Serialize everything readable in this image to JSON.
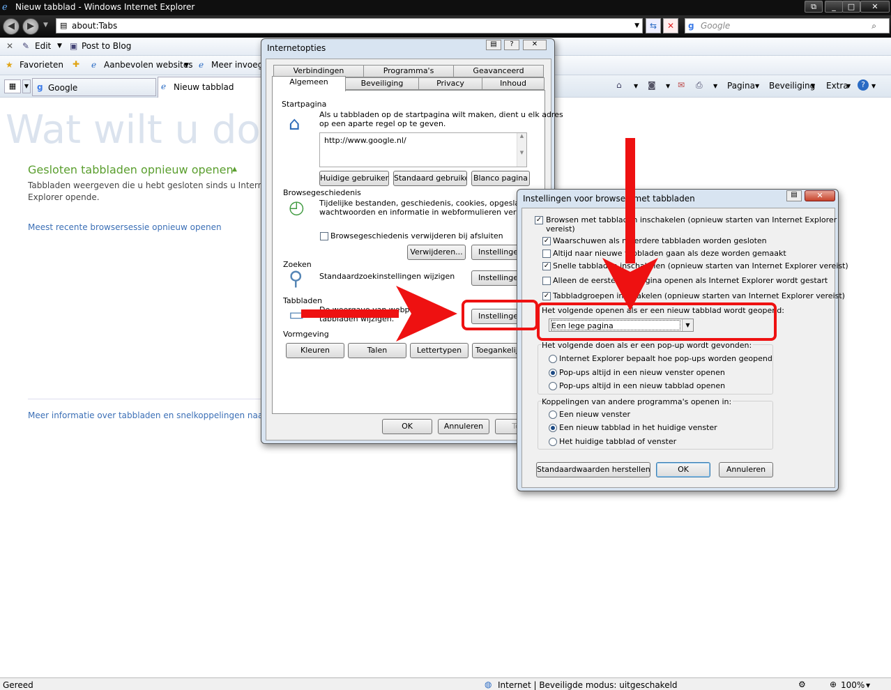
{
  "window": {
    "title": "Nieuw tabblad - Windows Internet Explorer",
    "address": "about:Tabs",
    "search_placeholder": "Google"
  },
  "toolbar1": {
    "edit": "Edit",
    "post_blog": "Post to Blog"
  },
  "favorites_bar": {
    "favorites": "Favorieten",
    "suggested": "Aanbevolen websites",
    "more": "Meer invoegt"
  },
  "tabs": [
    {
      "label": "Google"
    },
    {
      "label": "Nieuw tabblad"
    }
  ],
  "command_bar": {
    "page": "Pagina",
    "security": "Beveiliging",
    "extras": "Extra"
  },
  "content": {
    "heading": "Wat wilt u doe",
    "reopen_closed_title": "Gesloten tabbladen opnieuw openen",
    "reopen_closed_desc1": "Tabbladen weergeven die u hebt gesloten sinds u Interne",
    "reopen_closed_desc2": "Explorer opende.",
    "reopen_session": "Meest recente browsersessie opnieuw openen",
    "more_info": "Meer informatie over tabbladen en snelkoppelingen naar"
  },
  "status": {
    "left": "Gereed",
    "zone": "Internet | Beveiligde modus: uitgeschakeld",
    "zoom": "100%"
  },
  "internet_options": {
    "title": "Internetopties",
    "tabs_row1": [
      "Verbindingen",
      "Programma's",
      "Geavanceerd"
    ],
    "tabs_row2": [
      "Algemeen",
      "Beveiliging",
      "Privacy",
      "Inhoud"
    ],
    "startpage_label": "Startpagina",
    "startpage_desc1": "Als u tabbladen op de startpagina wilt maken, dient u elk adres",
    "startpage_desc2": "op een aparte regel op te geven.",
    "startpage_url": "http://www.google.nl/",
    "btn_current": "Huidige gebruiken",
    "btn_default": "Standaard gebruiken",
    "btn_blank": "Blanco pagina",
    "history_label": "Browsegeschiedenis",
    "history_desc1": "Tijdelijke bestanden, geschiedenis, cookies, opgeslagen",
    "history_desc2": "wachtwoorden en informatie in webformulieren verwijderen",
    "history_check": "Browsegeschiedenis verwijderen bij afsluiten",
    "btn_delete": "Verwijderen...",
    "btn_settings": "Instellingen",
    "search_label": "Zoeken",
    "search_desc": "Standaardzoekinstellingen wijzigen",
    "tabs_label": "Tabbladen",
    "tabs_desc1": "De weergave van webpagina's",
    "tabs_desc2": "tabbladen wijzigen.",
    "appearance_label": "Vormgeving",
    "btn_colors": "Kleuren",
    "btn_languages": "Talen",
    "btn_fonts": "Lettertypen",
    "btn_access": "Toegankelijkh",
    "btn_ok": "OK",
    "btn_cancel": "Annuleren",
    "btn_apply": "Toep"
  },
  "tab_settings": {
    "title": "Instellingen voor browsen met tabbladen",
    "opt1a": "Browsen met tabbladen inschakelen (opnieuw starten van Internet Explorer",
    "opt1b": "vereist)",
    "opt2": "Waarschuwen als meerdere tabbladen worden gesloten",
    "opt3": "Altijd naar nieuwe tabbladen gaan als deze worden gemaakt",
    "opt4": "Snelle tabbladen inschakelen (opnieuw starten van Internet Explorer vereist)",
    "opt5": "Alleen de eerste startpagina openen als Internet Explorer wordt gestart",
    "opt6": "Tabbladgroepen inschakelen (opnieuw starten van Internet Explorer vereist)",
    "newtab_label": "Het volgende openen als er een nieuw tabblad wordt geopend:",
    "newtab_value": "Een lege pagina",
    "popup_label": "Het volgende doen als er een pop-up wordt gevonden:",
    "popup1": "Internet Explorer bepaalt hoe pop-ups worden geopend",
    "popup2": "Pop-ups altijd in een nieuw venster openen",
    "popup3": "Pop-ups altijd in een nieuw tabblad openen",
    "links_label": "Koppelingen van andere programma's openen in:",
    "links1": "Een nieuw venster",
    "links2": "Een nieuw tabblad in het huidige venster",
    "links3": "Het huidige tabblad of venster",
    "btn_restore": "Standaardwaarden herstellen",
    "btn_ok": "OK",
    "btn_cancel": "Annuleren"
  }
}
